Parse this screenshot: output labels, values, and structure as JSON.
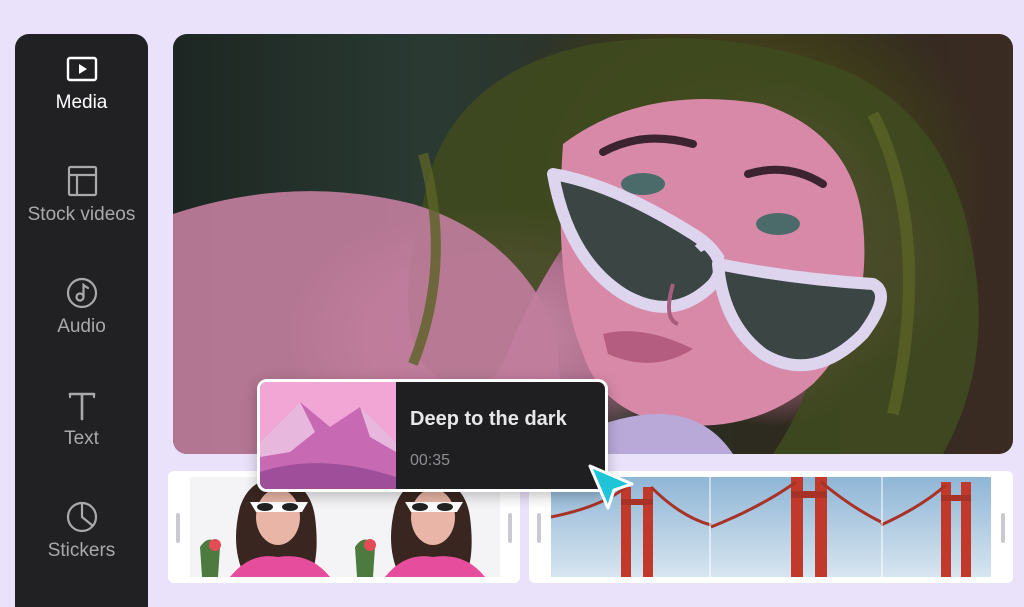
{
  "sidebar": {
    "items": [
      {
        "label": "Media",
        "icon": "play-icon",
        "active": true
      },
      {
        "label": "Stock videos",
        "icon": "layout-icon",
        "active": false
      },
      {
        "label": "Audio",
        "icon": "music-note-icon",
        "active": false
      },
      {
        "label": "Text",
        "icon": "text-icon",
        "active": false
      },
      {
        "label": "Stickers",
        "icon": "sticker-icon",
        "active": false
      }
    ]
  },
  "tooltip": {
    "title": "Deep to the dark",
    "duration": "00:35"
  },
  "colors": {
    "sidebar_bg": "#212123",
    "background": "#eae2fa",
    "accent_cursor": "#20c4d8",
    "tooltip_bg": "#1f1f21"
  }
}
